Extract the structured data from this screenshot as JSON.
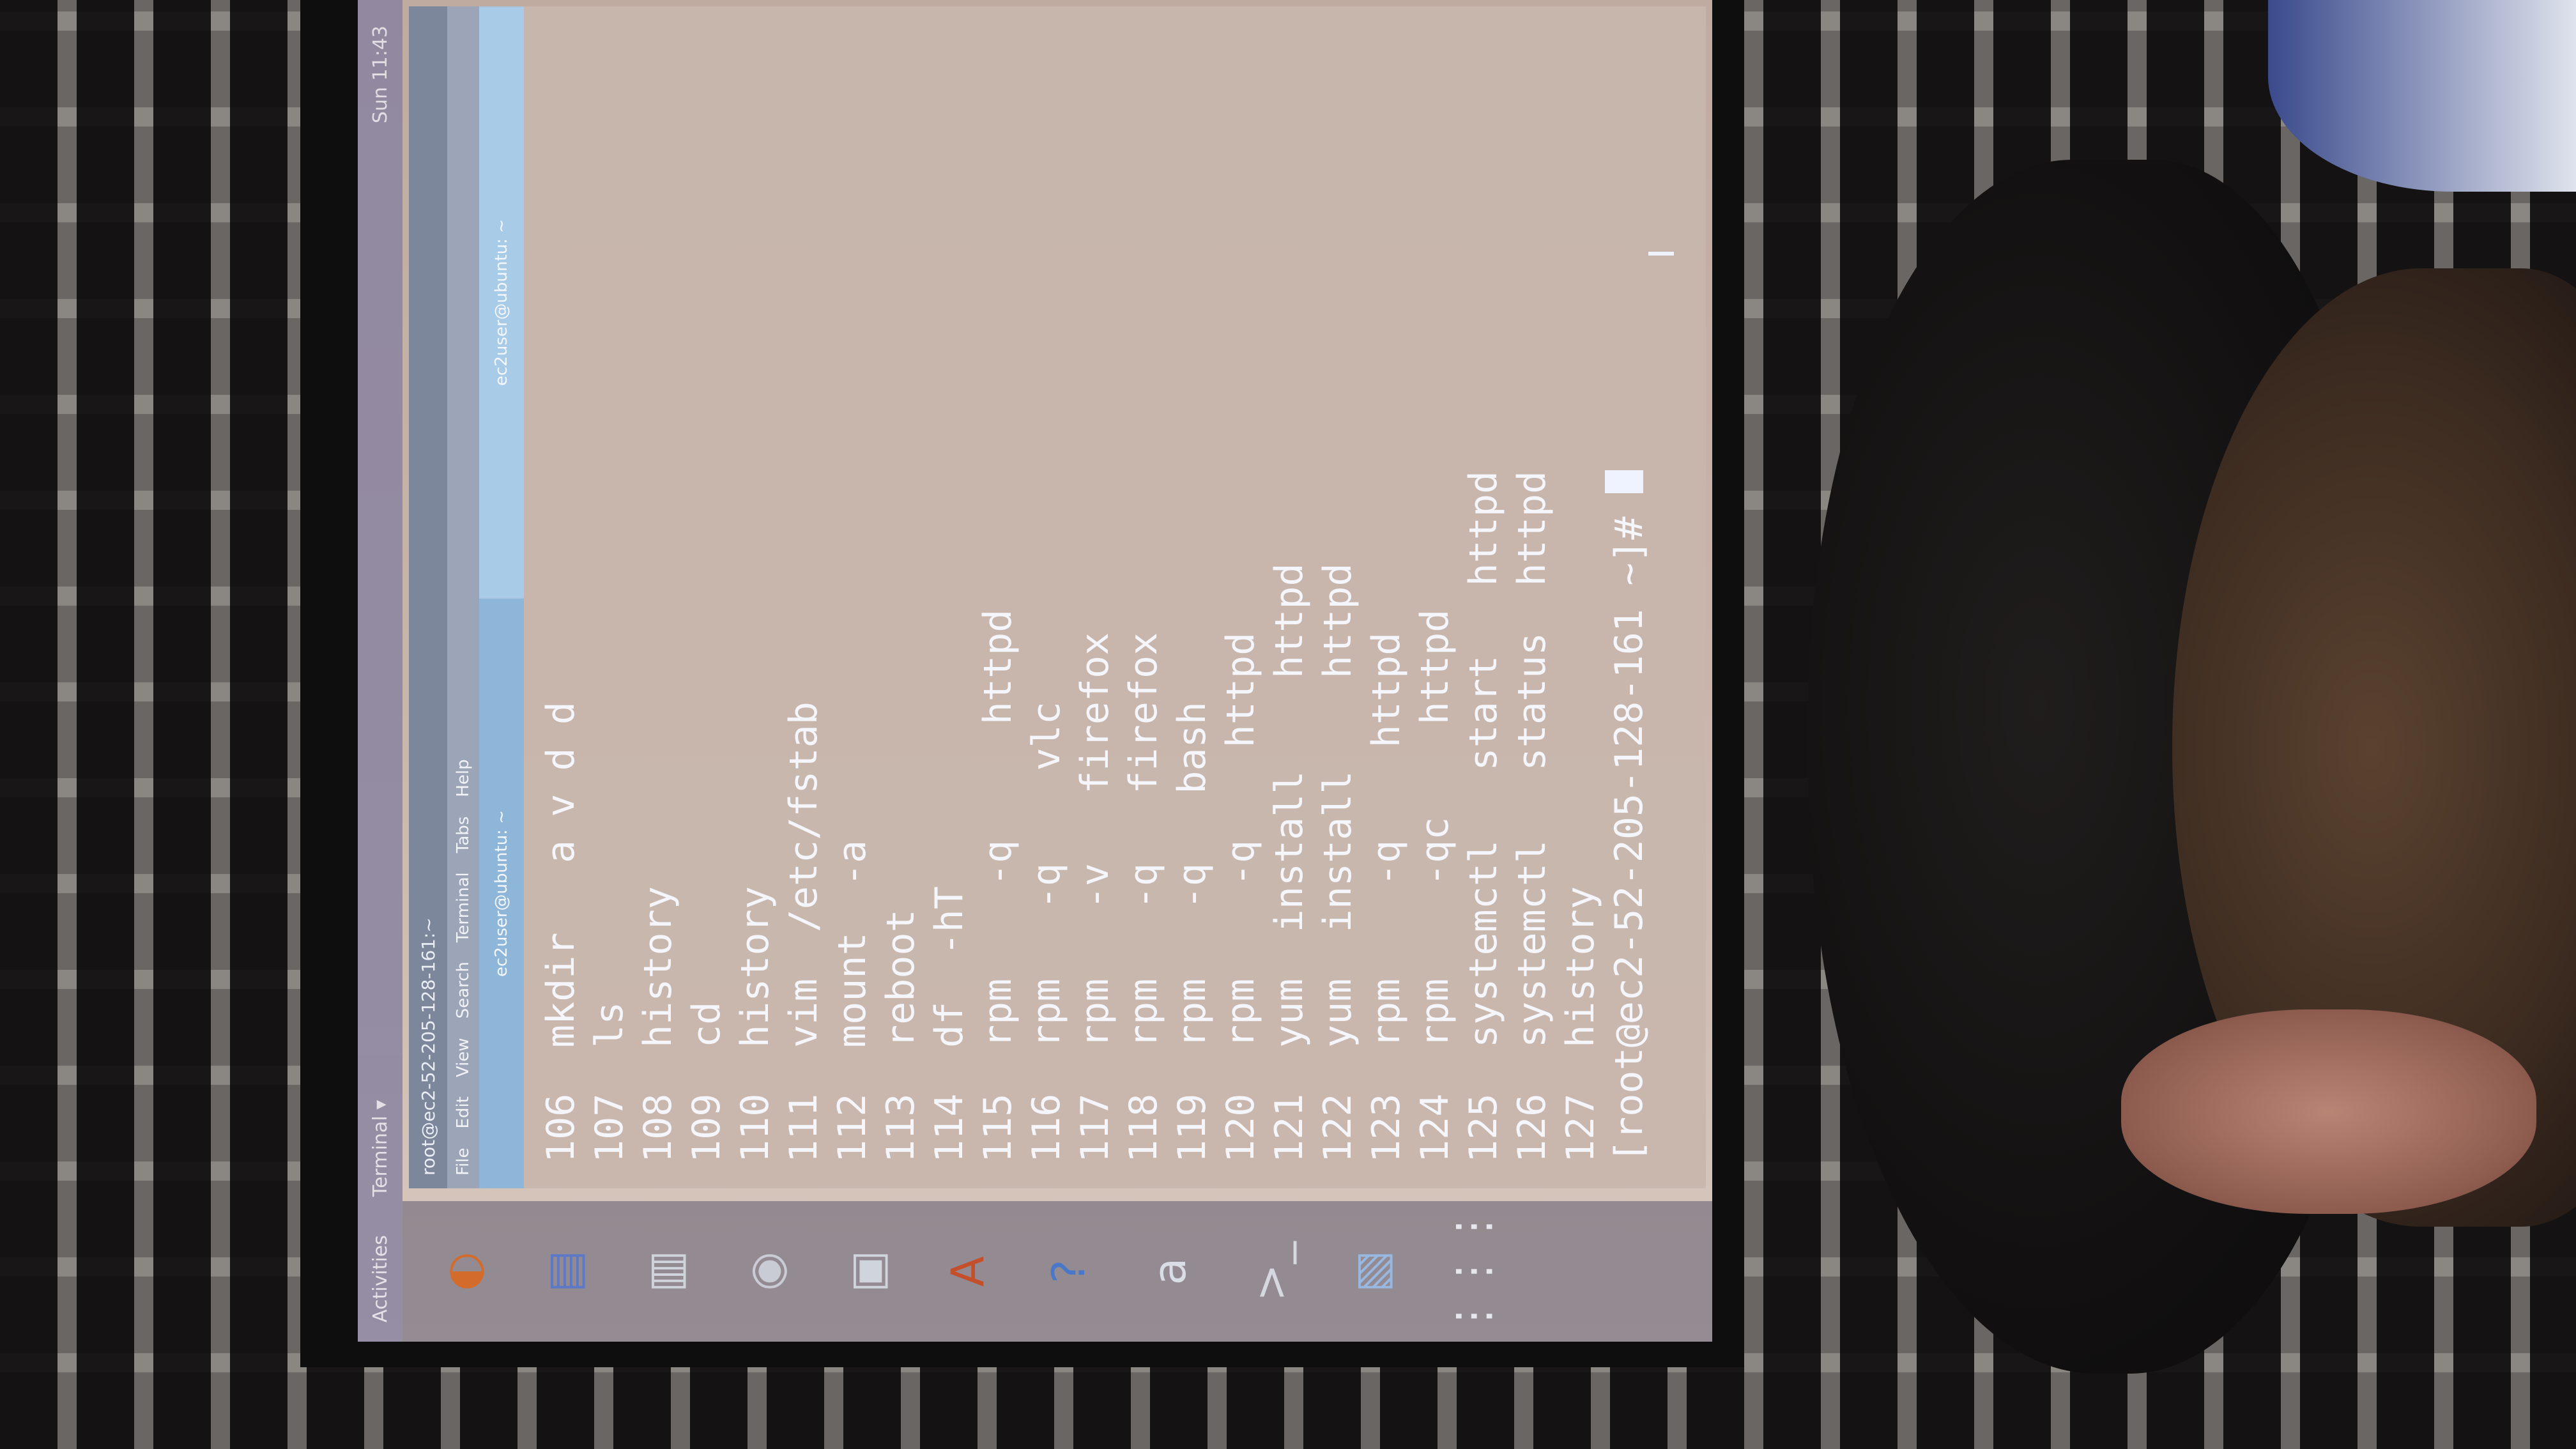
{
  "topbar": {
    "activities": "Activities",
    "app_menu": "Terminal ▾",
    "clock": "Sun 11:43"
  },
  "window": {
    "title": "root@ec2-52-205-128-161:~",
    "menu": [
      "File",
      "Edit",
      "View",
      "Search",
      "Terminal",
      "Tabs",
      "Help"
    ],
    "tabs": [
      "ec2user@ubuntu: ~",
      "ec2user@ubuntu: ~"
    ]
  },
  "dock": {
    "items": [
      {
        "name": "firefox-icon",
        "glyph": "◐",
        "color": "#d36b2a"
      },
      {
        "name": "files-icon",
        "glyph": "▤",
        "color": "#5b79c7"
      },
      {
        "name": "text-editor-icon",
        "glyph": "▥",
        "color": "#cfd3da"
      },
      {
        "name": "camera-icon",
        "glyph": "◉",
        "color": "#c9ccd4"
      },
      {
        "name": "software-icon",
        "glyph": "▣",
        "color": "#d0d4dc"
      },
      {
        "name": "office-icon",
        "glyph": "A",
        "color": "#c4502b"
      },
      {
        "name": "help-icon",
        "glyph": "?",
        "color": "#4a78c9"
      },
      {
        "name": "amazon-icon",
        "glyph": "a",
        "color": "#d9dde5"
      },
      {
        "name": "terminal-icon",
        "glyph": ">_",
        "color": "#d5d8df"
      },
      {
        "name": "image-viewer-icon",
        "glyph": "▧",
        "color": "#97b8e0"
      },
      {
        "name": "app-grid-icon",
        "glyph": "⋮⋮⋮",
        "color": "#e6e8ee"
      }
    ]
  },
  "terminal": {
    "lines": [
      {
        "num": "106",
        "cmd": "mkdir   a v d d"
      },
      {
        "num": "107",
        "cmd": "ls"
      },
      {
        "num": "108",
        "cmd": "history"
      },
      {
        "num": "109",
        "cmd": "cd"
      },
      {
        "num": "110",
        "cmd": "history"
      },
      {
        "num": "111",
        "cmd": "vim  /etc/fstab"
      },
      {
        "num": "112",
        "cmd": "mount  -a"
      },
      {
        "num": "113",
        "cmd": "reboot"
      },
      {
        "num": "114",
        "cmd": "df  -hT"
      },
      {
        "num": "115",
        "cmd": "rpm    -q     httpd"
      },
      {
        "num": "116",
        "cmd": "rpm   -q    vlc"
      },
      {
        "num": "117",
        "cmd": "rpm   -v   firefox"
      },
      {
        "num": "118",
        "cmd": "rpm   -q   firefox"
      },
      {
        "num": "119",
        "cmd": "rpm   -q   bash"
      },
      {
        "num": "120",
        "cmd": "rpm    -q    httpd"
      },
      {
        "num": "121",
        "cmd": "yum  install    httpd"
      },
      {
        "num": "122",
        "cmd": "yum  install    httpd"
      },
      {
        "num": "123",
        "cmd": "rpm    -q    httpd"
      },
      {
        "num": "124",
        "cmd": "rpm    -qc    httpd"
      },
      {
        "num": "125",
        "cmd": "systemctl   start   httpd"
      },
      {
        "num": "126",
        "cmd": "systemctl   status  httpd"
      },
      {
        "num": "127",
        "cmd": "history"
      }
    ],
    "prompt": "[root@ec2-52-205-128-161 ~]# "
  }
}
